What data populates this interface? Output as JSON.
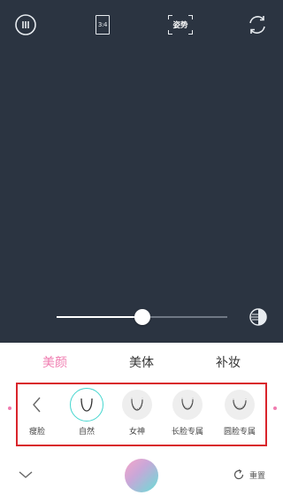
{
  "top_bar": {
    "menu_icon": "more-dots-icon",
    "ratio_label": "3:4",
    "pose_label": "姿势",
    "flip_icon": "camera-flip-icon"
  },
  "slider": {
    "value_fraction": 0.5,
    "contrast_icon": "contrast-icon"
  },
  "tabs": [
    {
      "label": "美颜",
      "active": true
    },
    {
      "label": "美体",
      "active": false
    },
    {
      "label": "补妆",
      "active": false
    }
  ],
  "face_panel": {
    "back_label": "瘦脸",
    "items": [
      {
        "label": "自然",
        "selected": true
      },
      {
        "label": "女神",
        "selected": false
      },
      {
        "label": "长脸专属",
        "selected": false
      },
      {
        "label": "圆脸专属",
        "selected": false
      }
    ]
  },
  "bottom_bar": {
    "reset_label": "重置"
  },
  "colors": {
    "camera_bg": "#2b3441",
    "accent_pink": "#f07cb0",
    "accent_teal": "#45d6cf",
    "highlight_red": "#d9242b"
  }
}
